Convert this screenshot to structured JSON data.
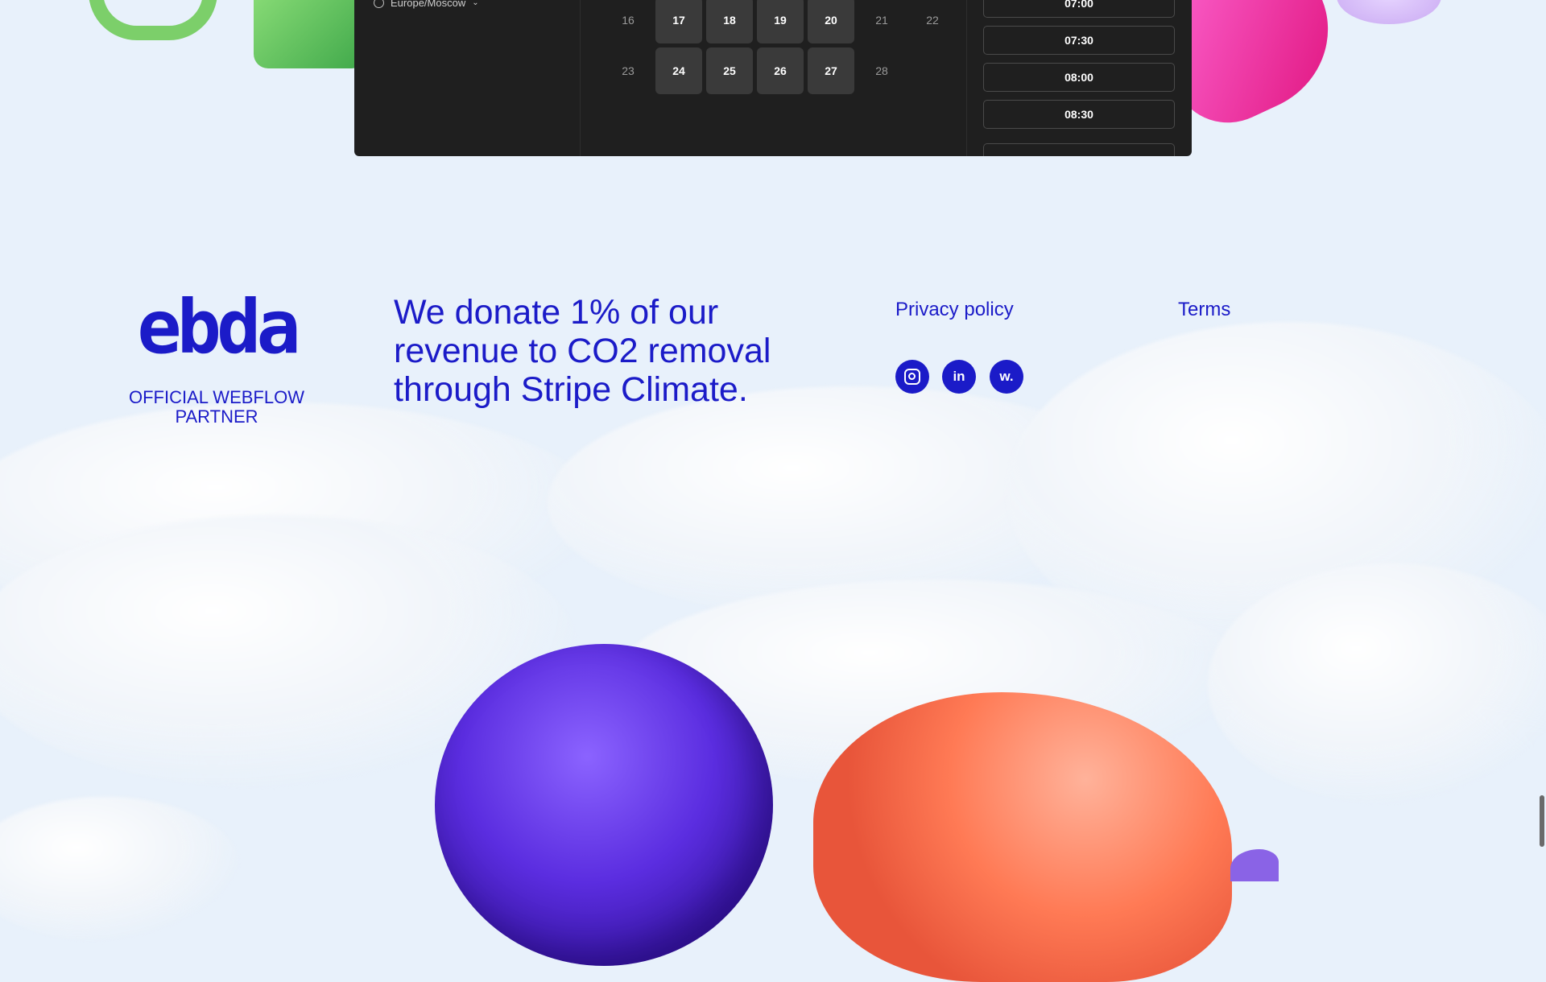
{
  "booking": {
    "timezone": "Europe/Moscow",
    "weeks": [
      [
        {
          "day": "16",
          "available": false
        },
        {
          "day": "17",
          "available": true
        },
        {
          "day": "18",
          "available": true
        },
        {
          "day": "19",
          "available": true
        },
        {
          "day": "20",
          "available": true
        },
        {
          "day": "21",
          "available": false
        },
        {
          "day": "22",
          "available": false
        }
      ],
      [
        {
          "day": "23",
          "available": false
        },
        {
          "day": "24",
          "available": true
        },
        {
          "day": "25",
          "available": true
        },
        {
          "day": "26",
          "available": true
        },
        {
          "day": "27",
          "available": true
        },
        {
          "day": "28",
          "available": false
        }
      ]
    ],
    "time_slots": [
      "07:00",
      "07:30",
      "08:00",
      "08:30"
    ]
  },
  "footer": {
    "logo_text": "ebda",
    "partner_text": "OFFICIAL WEBFLOW PARTNER",
    "donate_text": "We donate 1% of our revenue to CO2 removal through Stripe Climate.",
    "privacy_label": "Privacy policy",
    "terms_label": "Terms",
    "social": [
      {
        "name": "instagram-icon",
        "glyph": ""
      },
      {
        "name": "linkedin-icon",
        "glyph": "in"
      },
      {
        "name": "webflow-icon",
        "glyph": "w."
      }
    ]
  },
  "colors": {
    "brand": "#1b1bc8",
    "page_bg": "#e8f1fb",
    "widget_bg": "#1f1f1f"
  }
}
